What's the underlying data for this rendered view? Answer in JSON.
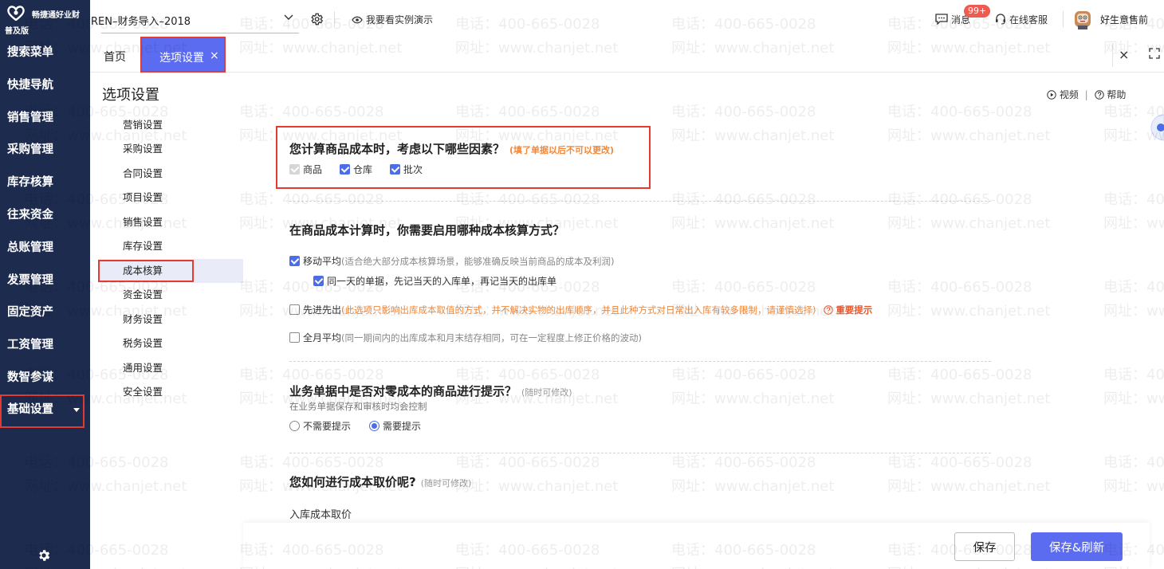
{
  "brand": {
    "name": "畅捷通好业财",
    "edition": "普及版"
  },
  "nav": {
    "items": [
      {
        "label": "搜索菜单"
      },
      {
        "label": "快捷导航"
      },
      {
        "label": "销售管理"
      },
      {
        "label": "采购管理"
      },
      {
        "label": "库存核算"
      },
      {
        "label": "往来资金"
      },
      {
        "label": "总账管理"
      },
      {
        "label": "发票管理"
      },
      {
        "label": "固定资产"
      },
      {
        "label": "工资管理"
      },
      {
        "label": "数智参谋"
      },
      {
        "label": "基础设置",
        "active": true
      }
    ],
    "bottom_icon": "gear-icon"
  },
  "topbar": {
    "account": "REN–财务导入–2018",
    "demo_link": "我要看实例演示",
    "messages_label": "消息",
    "messages_badge": "99+",
    "service_label": "在线客服",
    "username": "好生意售前"
  },
  "tabs": {
    "home": "首页",
    "active": "选项设置",
    "close_symbol": "×"
  },
  "page": {
    "title": "选项设置",
    "video_label": "视频",
    "help_label": "帮助",
    "separator": "|"
  },
  "submenu": {
    "items": [
      {
        "label": "营销设置"
      },
      {
        "label": "采购设置"
      },
      {
        "label": "合同设置"
      },
      {
        "label": "项目设置"
      },
      {
        "label": "销售设置"
      },
      {
        "label": "库存设置"
      },
      {
        "label": "成本核算",
        "active": true
      },
      {
        "label": "资金设置"
      },
      {
        "label": "财务设置"
      },
      {
        "label": "税务设置"
      },
      {
        "label": "通用设置"
      },
      {
        "label": "安全设置"
      }
    ]
  },
  "sections": {
    "factors": {
      "title": "您计算商品成本时，考虑以下哪些因素？",
      "note": "(填了单据以后不可以更改)",
      "options": [
        {
          "label": "商品",
          "state": "disabled-checked"
        },
        {
          "label": "仓库",
          "state": "checked"
        },
        {
          "label": "批次",
          "state": "checked"
        }
      ]
    },
    "method": {
      "title": "在商品成本计算时，你需要启用哪种成本核算方式？",
      "moving_avg": {
        "label": "移动平均",
        "desc": "(适合绝大部分成本核算场景，能够准确反映当前商品的成本及利润)",
        "checked": true
      },
      "same_day": {
        "label": "同一天的单据，先记当天的入库单，再记当天的出库单",
        "checked": true
      },
      "fifo": {
        "label": "先进先出",
        "desc": "(此选项只影响出库成本取值的方式，并不解决实物的出库顺序，并且此种方式对日常出入库有较多限制，请谨慎选择)",
        "important": "重要提示",
        "checked": false
      },
      "monthly_avg": {
        "label": "全月平均",
        "desc": "(同一期间内的出库成本和月末结存相同，可在一定程度上修正价格的波动)",
        "checked": false
      }
    },
    "zero_cost": {
      "title": "业务单据中是否对零成本的商品进行提示？",
      "note": "(随时可修改)",
      "sub": "在业务单据保存和审核时均会控制",
      "options": [
        {
          "label": "不需要提示",
          "selected": false
        },
        {
          "label": "需要提示",
          "selected": true
        }
      ]
    },
    "pricing": {
      "title": "您如何进行成本取价呢?",
      "note": "(随时可修改)",
      "inbound_label": "入库成本取价"
    }
  },
  "footer": {
    "save": "保存",
    "save_refresh": "保存&刷新"
  },
  "watermark": {
    "phone": "电话：400-665-0028",
    "site": "网址：www.chanjet.net"
  },
  "colors": {
    "sidebar_bg": "#1d2b4f",
    "accent": "#5b6cf0",
    "highlight_border": "#e23c32",
    "warn": "#f0883a",
    "badge": "#f05a4f"
  }
}
